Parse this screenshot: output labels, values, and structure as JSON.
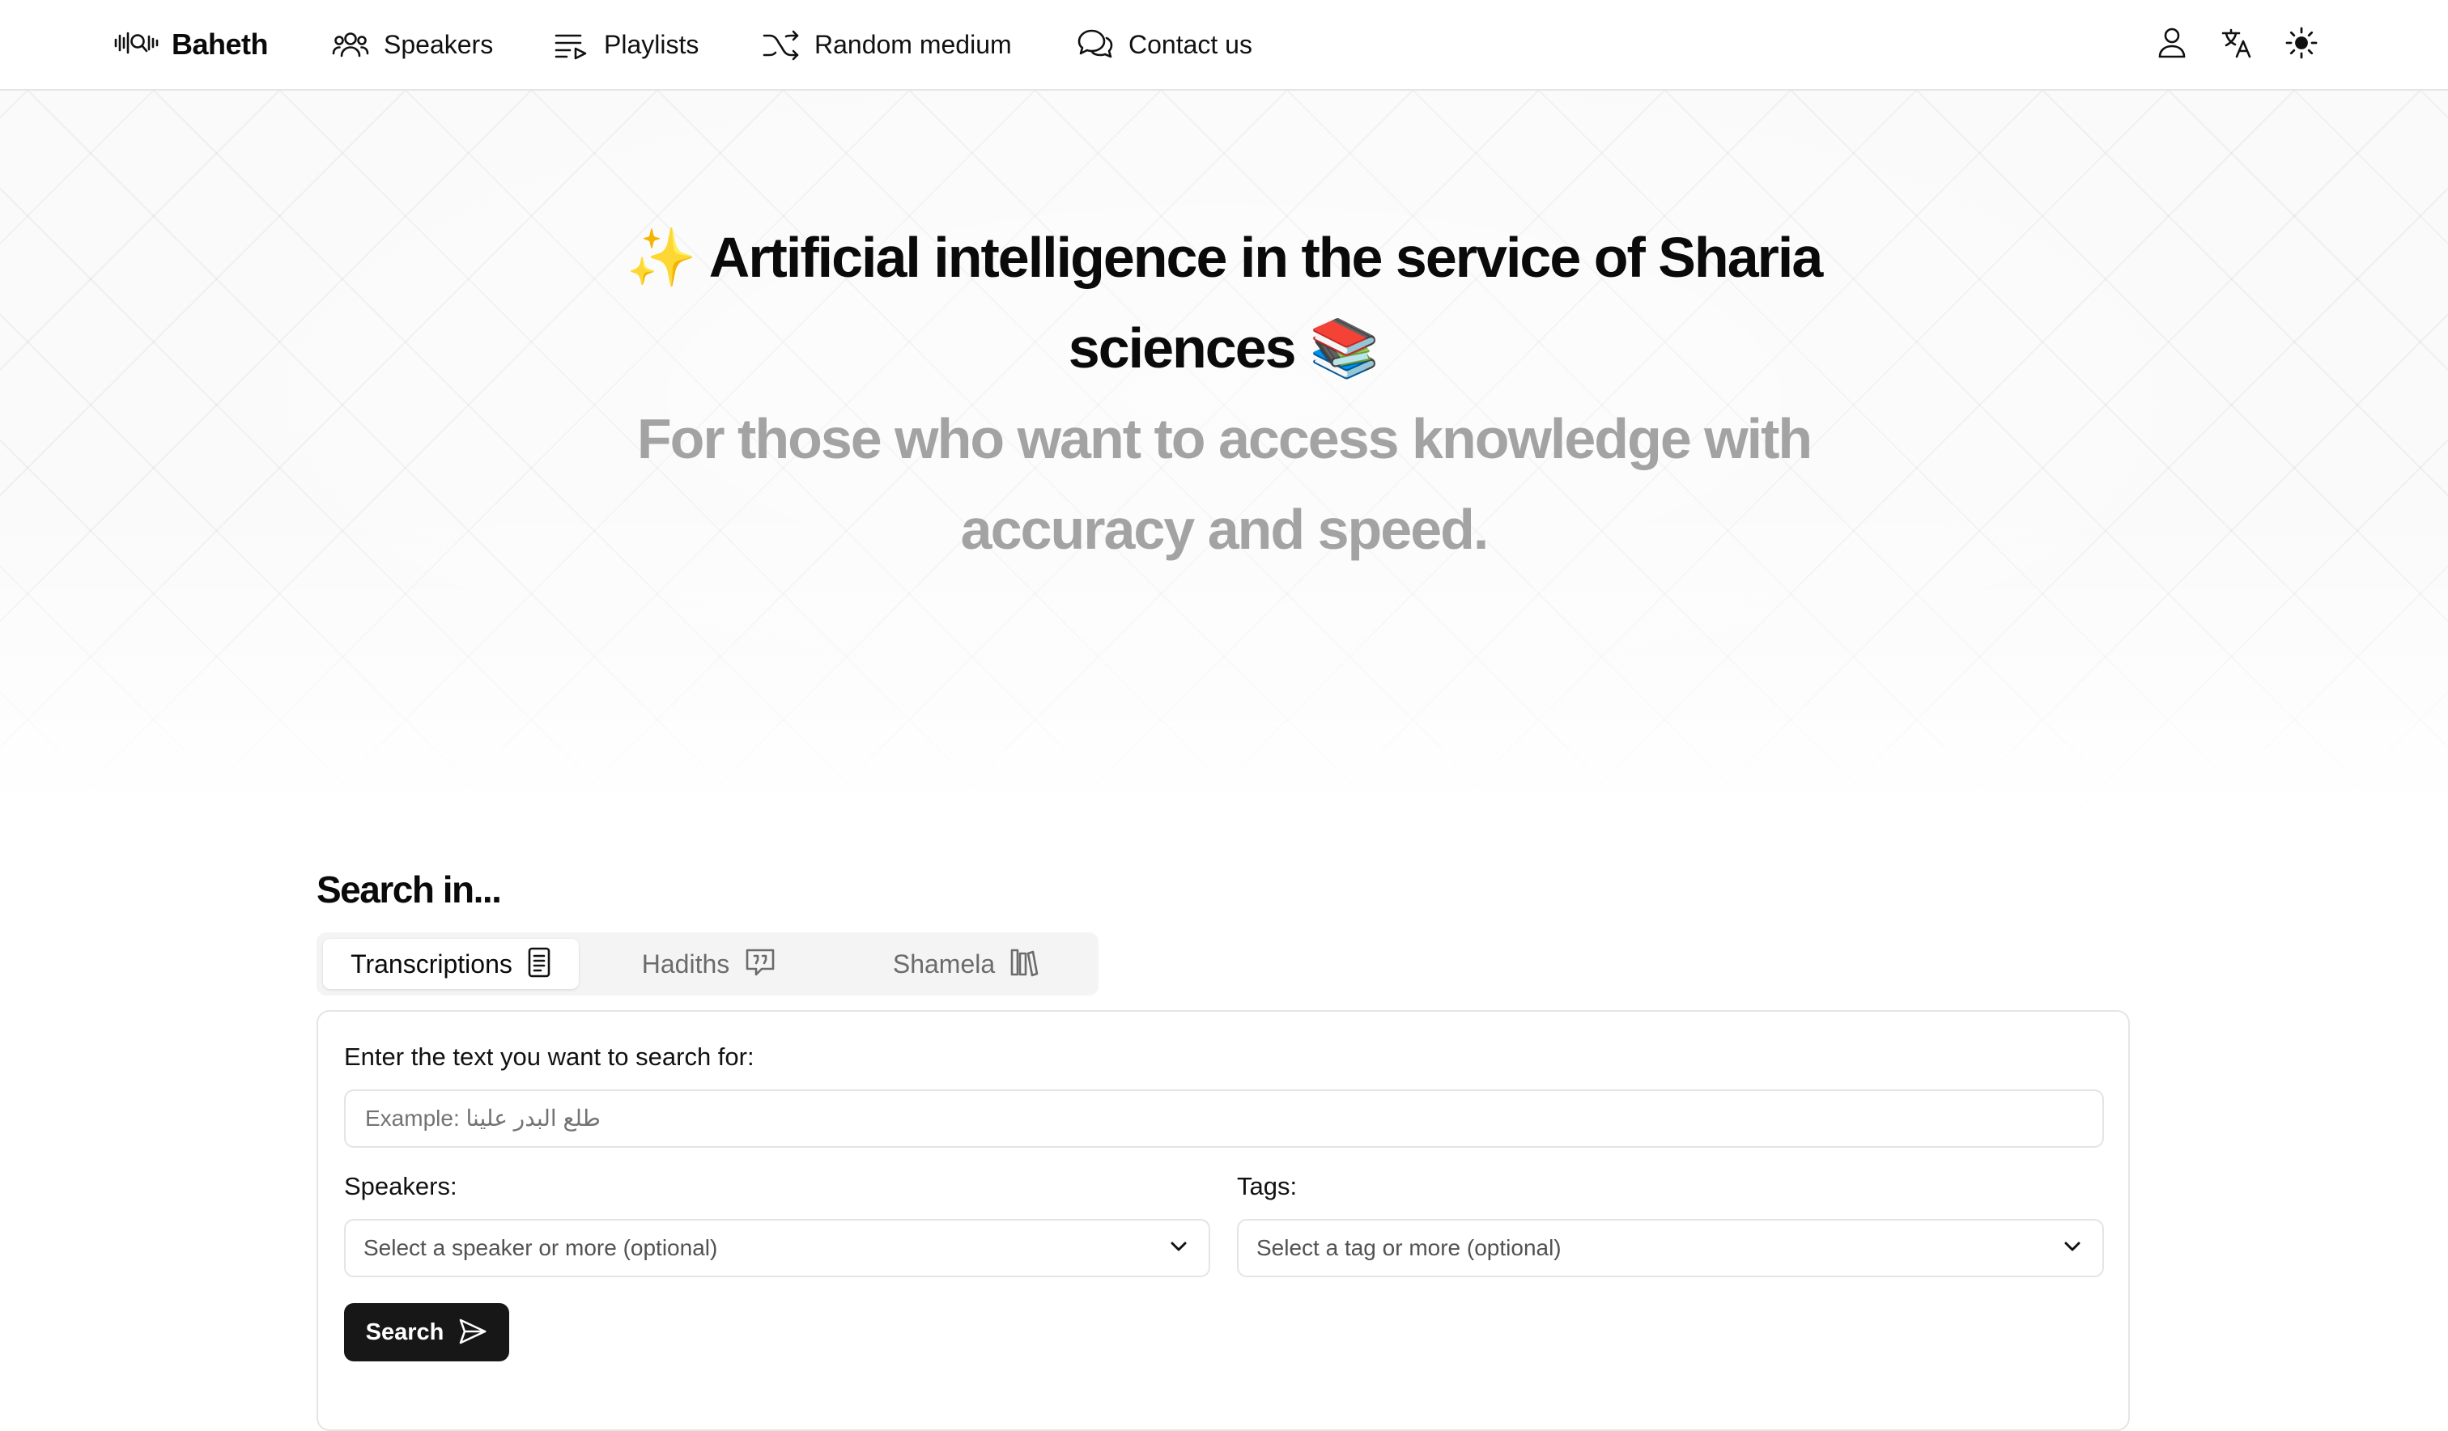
{
  "nav": {
    "brand": "Baheth",
    "items": [
      {
        "label": "Speakers",
        "icon": "users-icon"
      },
      {
        "label": "Playlists",
        "icon": "list-play-icon"
      },
      {
        "label": "Random medium",
        "icon": "shuffle-icon"
      },
      {
        "label": "Contact us",
        "icon": "message-circle-icon"
      }
    ],
    "right_icons": [
      "user-icon",
      "languages-icon",
      "sun-icon"
    ]
  },
  "hero": {
    "title_emoji_left": "✨",
    "title": "Artificial intelligence in the service of Sharia sciences",
    "title_emoji_right": "📚",
    "subtitle": "For those who want to access knowledge with accuracy and speed."
  },
  "search": {
    "heading": "Search in...",
    "tabs": [
      {
        "label": "Transcriptions",
        "icon": "document-icon",
        "active": true
      },
      {
        "label": "Hadiths",
        "icon": "quote-message-icon",
        "active": false
      },
      {
        "label": "Shamela",
        "icon": "library-icon",
        "active": false
      }
    ],
    "query_label": "Enter the text you want to search for:",
    "query_placeholder": "Example: طلع البدر علينا",
    "query_value": "",
    "speakers_label": "Speakers:",
    "speakers_placeholder": "Select a speaker or more (optional)",
    "tags_label": "Tags:",
    "tags_placeholder": "Select a tag or more (optional)",
    "submit_label": "Search"
  },
  "colors": {
    "text": "#0a0a0a",
    "muted_heading": "#a3a3a3",
    "button_bg": "#171717",
    "border": "#e5e5e5",
    "tabs_bg": "#f4f4f5"
  }
}
